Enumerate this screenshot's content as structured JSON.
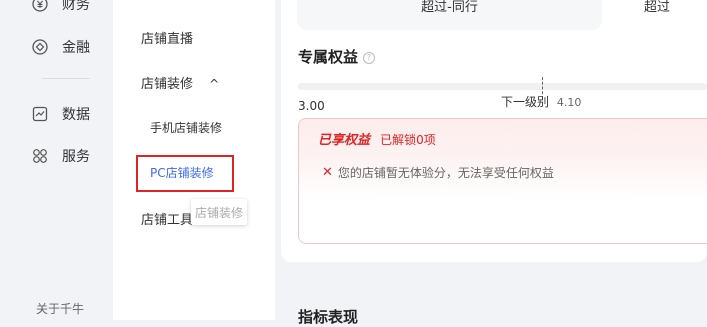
{
  "left_nav": {
    "items": [
      {
        "label": "财务",
        "icon": "finance-icon"
      },
      {
        "label": "金融",
        "icon": "circle-diamond-icon"
      },
      {
        "label": "数据",
        "icon": "chart-line-icon"
      },
      {
        "label": "服务",
        "icon": "grid-circles-icon"
      }
    ],
    "footer": "关于千牛"
  },
  "sidebar": {
    "item_live": "店铺直播",
    "item_decor": "店铺装修",
    "item_decor_chevron": "^",
    "sub_mobile": "手机店铺装修",
    "sub_pc": "PC店铺装修",
    "item_tools": "店铺工具",
    "tooltip": "店铺装修"
  },
  "main": {
    "top_tab_left": "超过-同行",
    "top_tab_right": "超过",
    "benefits_title": "专属权益",
    "progress_value": "3.00",
    "next_level_label": "下一级别",
    "next_level_value": "4.10",
    "benefit_enjoyed": "已享权益",
    "benefit_unlocked": "已解锁0项",
    "benefit_message": "您的店铺暂无体验分，无法享受任何权益",
    "metrics_title": "指标表现"
  },
  "colors": {
    "accent_red": "#e02424",
    "accent_blue": "#3d6cf5"
  }
}
